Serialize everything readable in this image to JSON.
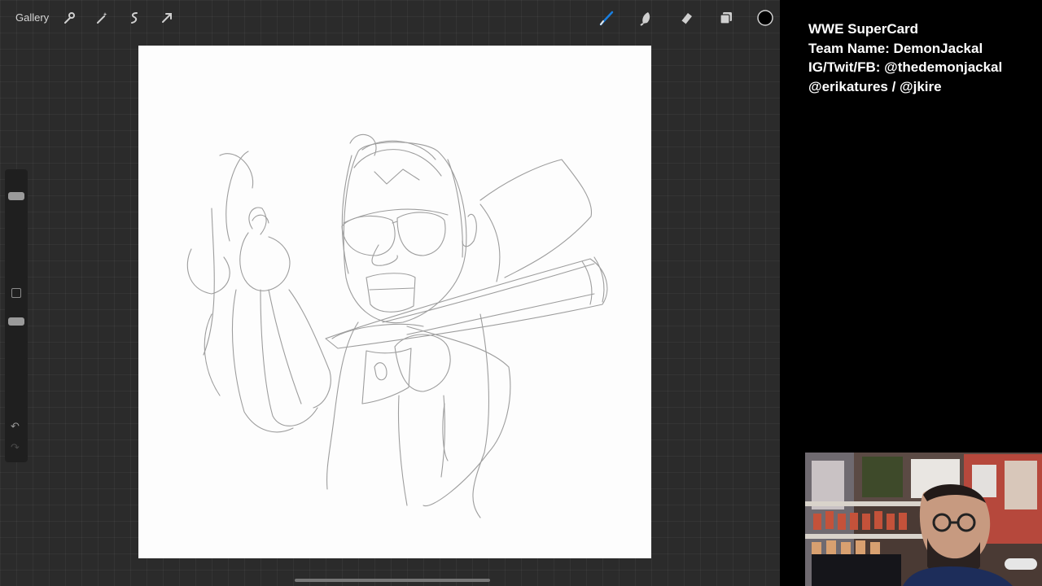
{
  "app": {
    "gallery_label": "Gallery",
    "toolbar_left_icons": [
      "wrench-icon",
      "magic-wand-icon",
      "selection-icon",
      "transform-arrow-icon"
    ],
    "toolbar_right_icons": [
      "brush-icon",
      "smudge-icon",
      "eraser-icon",
      "layers-icon",
      "color-swatch-icon"
    ],
    "accent_color": "#1a7fe0",
    "current_color": "#000000"
  },
  "stream_overlay": {
    "lines": [
      "WWE SuperCard",
      "Team Name: DemonJackal",
      "IG/Twit/FB: @thedemonjackal",
      "@erikatures / @jkire"
    ]
  },
  "webcam": {
    "content": "streamer-webcam-feed"
  }
}
